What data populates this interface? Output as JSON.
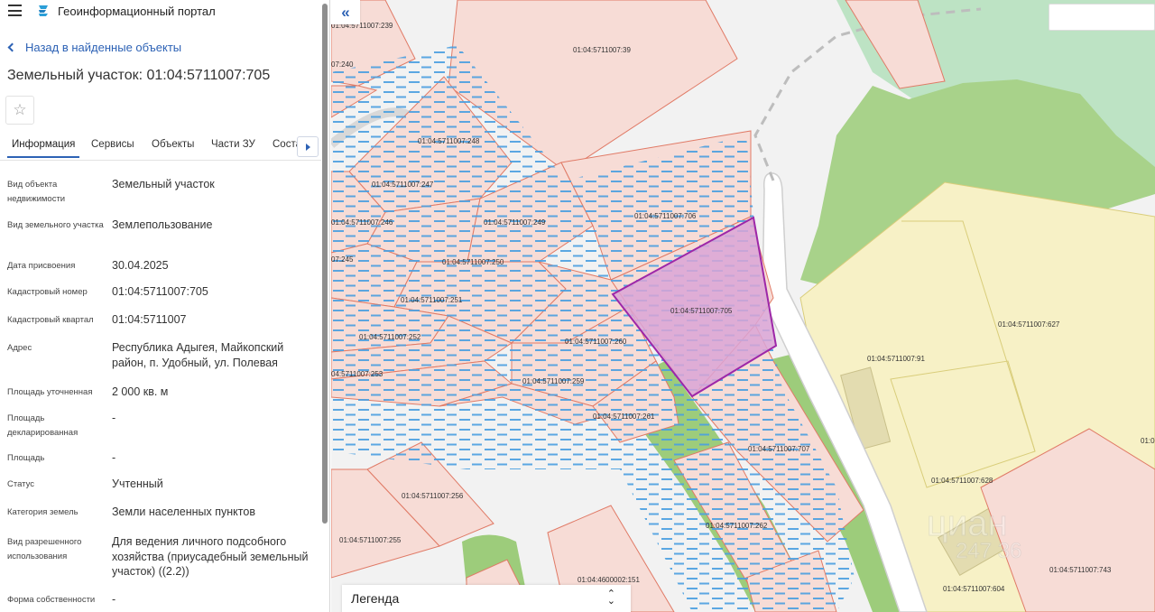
{
  "header": {
    "app_title": "Геоинформационный портал"
  },
  "back_link": "Назад в найденные объекты",
  "page_title": "Земельный участок: 01:04:5711007:705",
  "tabs": [
    "Информация",
    "Сервисы",
    "Объекты",
    "Части ЗУ",
    "Соста"
  ],
  "properties": [
    {
      "label": "Вид объекта недвижимости",
      "value": "Земельный участок"
    },
    {
      "label": "Вид земельного участка",
      "value": "Землепользование"
    },
    {
      "label": "Дата присвоения",
      "value": "30.04.2025"
    },
    {
      "label": "Кадастровый номер",
      "value": "01:04:5711007:705"
    },
    {
      "label": "Кадастровый квартал",
      "value": "01:04:5711007"
    },
    {
      "label": "Адрес",
      "value": "Республика Адыгея, Майкопский район, п. Удобный, ул. Полевая"
    },
    {
      "label": "Площадь уточненная",
      "value": "2 000 кв. м"
    },
    {
      "label": "Площадь декларированная",
      "value": "-"
    },
    {
      "label": "Площадь",
      "value": "-"
    },
    {
      "label": "Статус",
      "value": "Учтенный"
    },
    {
      "label": "Категория земель",
      "value": "Земли населенных пунктов"
    },
    {
      "label": "Вид разрешенного использования",
      "value": "Для ведения личного подсобного хозяйства (приусадебный земельный участок) ((2.2))"
    },
    {
      "label": "Форма собственности",
      "value": "-"
    }
  ],
  "map": {
    "legend_label": "Легенда",
    "parcel_labels": [
      "01:04:5711007:239",
      "07:240",
      "01:04:5711007:39",
      "01:04:5711007:248",
      "01:04:5711007:247",
      "01:04:5711007:246",
      "01:04:5711007:249",
      "01:04:5711007:706",
      "07:245",
      "01:04:5711007:250",
      "01:04:5711007:251",
      "01:04:5711007:705",
      "01:04:5711007:252",
      "01:04:5711007:260",
      "04:5711007:253",
      "01:04:5711007:259",
      "01:04:5711007:261",
      "01:04:5711007:707",
      "01:04:5711007:627",
      "01:04:5711007:91",
      "01:04:5711007:256",
      "01:04:5711007:628",
      "01:04:5711007:255",
      "01:04:5711007:262",
      "01:04:4600002:151",
      "01:04:5711007:604",
      "01:04:5711007:743",
      "01:0"
    ],
    "watermark_text": "циан",
    "watermark_number": "247 36",
    "colors": {
      "parcel_fill": "#f7dcd6",
      "parcel_stroke": "#e07a66",
      "selected_fill": "#dba4d6",
      "selected_stroke": "#9d27a8",
      "zone_fill": "#f7f1c6",
      "water_dash": "#4a9fe0",
      "green": "#9dcc7b",
      "accent": "#2d62b5"
    }
  }
}
